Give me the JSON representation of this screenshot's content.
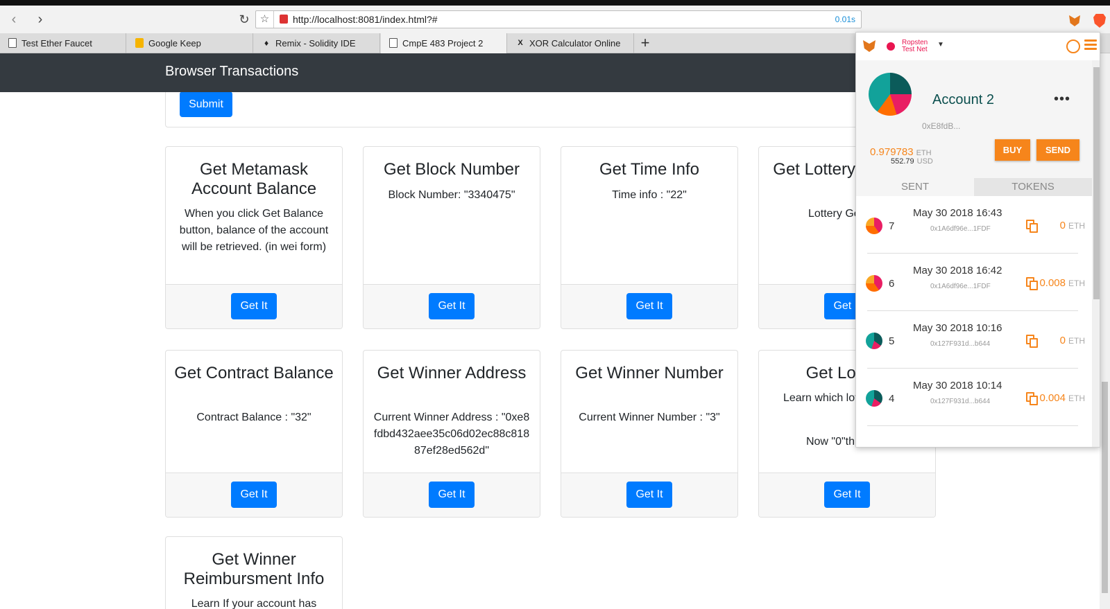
{
  "browser": {
    "url": "http://localhost:8081/index.html?#",
    "load_time": "0.01s",
    "tabs": [
      {
        "label": "Test Ether Faucet",
        "icon": "document-icon"
      },
      {
        "label": "Google Keep",
        "icon": "keep-icon"
      },
      {
        "label": "Remix - Solidity IDE",
        "icon": "remix-icon"
      },
      {
        "label": "CmpE 483 Project 2",
        "icon": "document-icon",
        "active": true
      },
      {
        "label": "XOR Calculator Online",
        "icon": "xor-icon"
      }
    ]
  },
  "page": {
    "brand": "Browser Transactions",
    "submit_label": "Submit",
    "cards": [
      {
        "title": "Get Metamask Account Balance",
        "body": "When you click Get Balance button, balance of the account will be retrieved. (in wei form)",
        "button": "Get It"
      },
      {
        "title": "Get Block Number",
        "body": "Block Number: \"3340475\"",
        "button": "Get It"
      },
      {
        "title": "Get Time Info",
        "body": "Time info : \"22\"",
        "button": "Get It"
      },
      {
        "title": "Get Lottery Genesis",
        "body": "Lottery Genesis",
        "button": "Get It"
      },
      {
        "title": "Get Contract Balance",
        "body": "Contract Balance : \"32\"",
        "button": "Get It"
      },
      {
        "title": "Get Winner Address",
        "body": "Current Winner Address : \"0xe8fdbd432aee35c06d02ec88c81887ef28ed562d\"",
        "button": "Get It"
      },
      {
        "title": "Get Winner Number",
        "body": "Current Winner Number : \"3\"",
        "button": "Get It"
      },
      {
        "title": "Get Lottery",
        "body": "Learn which lottery is now",
        "body2": "Now \"0\"th lottery",
        "button": "Get It"
      },
      {
        "title": "Get Winner Reimbursment Info",
        "body": "Learn If your account has"
      }
    ]
  },
  "metamask": {
    "network": "Ropsten Test Net",
    "network_color": "#e91550",
    "account_name": "Account 2",
    "more": "•••",
    "address": "0xE8fdB...",
    "balance": "0.979783",
    "balance_unit": "ETH",
    "usd": "552.79",
    "usd_unit": "USD",
    "buy_label": "BUY",
    "send_label": "SEND",
    "tab_sent": "SENT",
    "tab_tokens": "TOKENS",
    "accent": "#f6851b",
    "transactions": [
      {
        "nonce": "7",
        "date": "May 30 2018 16:43",
        "hash": "0x1A6df96e...1FDF",
        "amount": "0",
        "unit": "ETH"
      },
      {
        "nonce": "6",
        "date": "May 30 2018 16:42",
        "hash": "0x1A6df96e...1FDF",
        "amount": "0.008",
        "unit": "ETH"
      },
      {
        "nonce": "5",
        "date": "May 30 2018 10:16",
        "hash": "0x127F931d...b644",
        "amount": "0",
        "unit": "ETH"
      },
      {
        "nonce": "4",
        "date": "May 30 2018 10:14",
        "hash": "0x127F931d...b644",
        "amount": "0.004",
        "unit": "ETH"
      }
    ]
  }
}
